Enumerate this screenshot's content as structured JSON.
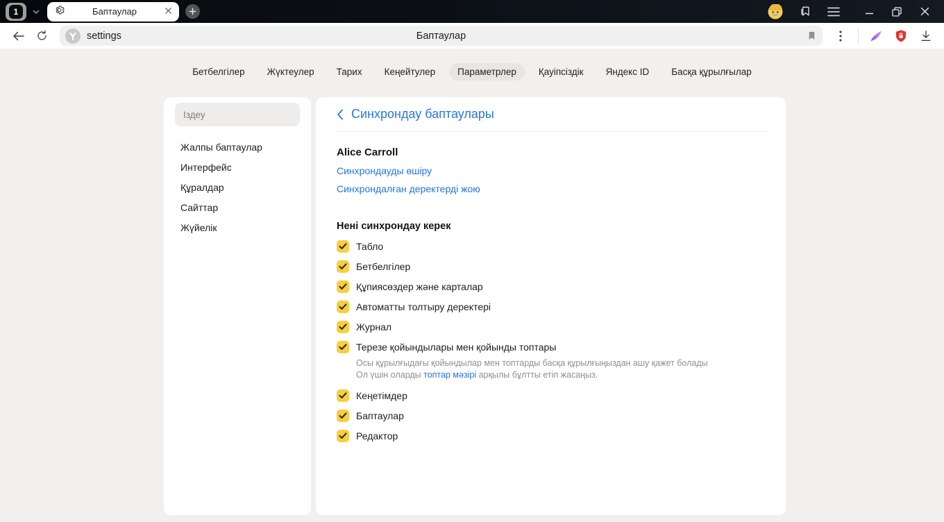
{
  "window": {
    "tab_counter": "1",
    "tab": {
      "title": "Баптаулар"
    }
  },
  "toolbar": {
    "url": "settings",
    "page_title": "Баптаулар"
  },
  "nav": {
    "items": [
      {
        "label": "Бетбелгілер",
        "selected": false
      },
      {
        "label": "Жүктеулер",
        "selected": false
      },
      {
        "label": "Тарих",
        "selected": false
      },
      {
        "label": "Кеңейтулер",
        "selected": false
      },
      {
        "label": "Параметрлер",
        "selected": true
      },
      {
        "label": "Қауіпсіздік",
        "selected": false
      },
      {
        "label": "Яндекс ID",
        "selected": false
      },
      {
        "label": "Басқа құрылғылар",
        "selected": false
      }
    ]
  },
  "sidebar": {
    "search_placeholder": "Іздеу",
    "items": [
      "Жалпы баптаулар",
      "Интерфейс",
      "Құралдар",
      "Сайттар",
      "Жүйелік"
    ]
  },
  "main": {
    "header": "Синхрондау баптаулары",
    "account_name": "Alice Carroll",
    "links": [
      "Синхрондауды өшіру",
      "Синхрондалған деректерді жою"
    ],
    "section_title": "Нені синхрондау керек",
    "checkboxes": [
      {
        "label": "Табло",
        "checked": true
      },
      {
        "label": "Бетбелгілер",
        "checked": true
      },
      {
        "label": "Құпиясөздер және карталар",
        "checked": true
      },
      {
        "label": "Автоматты толтыру деректері",
        "checked": true
      },
      {
        "label": "Журнал",
        "checked": true
      },
      {
        "label": "Терезе қойындылары мен қойынды топтары",
        "checked": true,
        "desc_line1": "Осы құрылғыдағы қойындылар мен топтарды басқа құрылғыңыздан ашу қажет болады",
        "desc_pre": "Ол үшін оларды ",
        "desc_link": "топтар мәзірі",
        "desc_post": " арқылы бұлтты етіп жасаңыз."
      },
      {
        "label": "Кеңетімдер",
        "checked": true
      },
      {
        "label": "Баптаулар",
        "checked": true
      },
      {
        "label": "Редактор",
        "checked": true
      }
    ]
  },
  "colors": {
    "accent_blue": "#2374e1",
    "checkbox_yellow": "#f8cf3c",
    "page_bg": "#f1f0ee",
    "shield_red": "#e3342b",
    "feather_purple": "#9b6ade"
  }
}
